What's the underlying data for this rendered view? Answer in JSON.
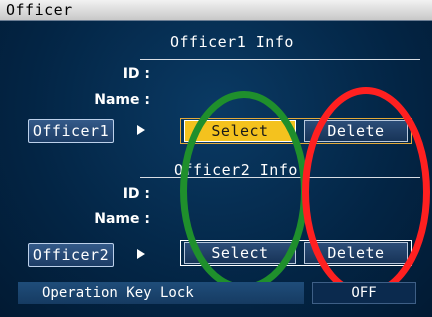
{
  "window": {
    "title": "Officer"
  },
  "officer1": {
    "section_title": "Officer1 Info",
    "id_label": "ID :",
    "name_label": "Name :",
    "button_label": "Officer1",
    "select_label": "Select",
    "delete_label": "Delete"
  },
  "officer2": {
    "section_title": "Officer2 Info",
    "id_label": "ID :",
    "name_label": "Name :",
    "button_label": "Officer2",
    "select_label": "Select",
    "delete_label": "Delete"
  },
  "operation_key_lock": {
    "label": "Operation Key Lock",
    "value": "OFF"
  },
  "annotations": {
    "green_ellipse_color": "#1f8f2c",
    "red_ellipse_color": "#ff2020"
  },
  "colors": {
    "background": "#03213f",
    "select_active": "#f4c21e",
    "active_frame": "#e2a93a"
  }
}
